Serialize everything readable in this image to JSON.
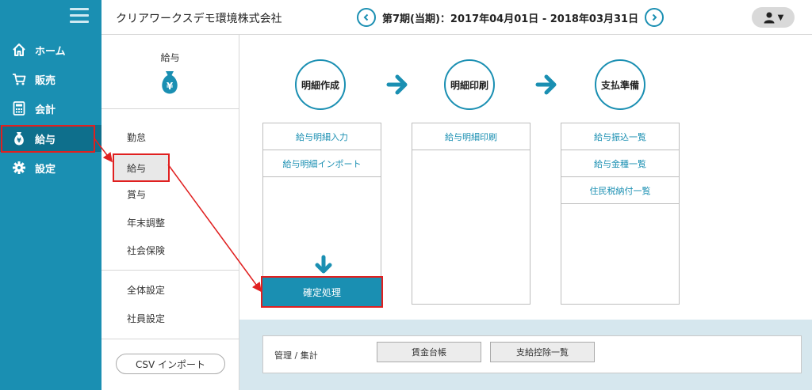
{
  "sidebar": {
    "items": [
      {
        "label": "ホーム",
        "icon": "home-icon"
      },
      {
        "label": "販売",
        "icon": "cart-icon"
      },
      {
        "label": "会計",
        "icon": "calculator-icon"
      },
      {
        "label": "給与",
        "icon": "money-bag-icon"
      },
      {
        "label": "設定",
        "icon": "gear-icon"
      }
    ],
    "active_index": 3
  },
  "header": {
    "company": "クリアワークスデモ環境株式会社",
    "period": "第7期(当期)：2017年04月01日 - 2018年03月31日"
  },
  "submenu": {
    "title": "給与",
    "groups": [
      [
        "勤怠",
        "給与",
        "賞与",
        "年末調整",
        "社会保険"
      ],
      [
        "全体設定",
        "社員設定"
      ]
    ],
    "selected": "給与",
    "csv_button": "CSV インポート"
  },
  "flow": {
    "steps": [
      {
        "label": "明細作成",
        "items": [
          "給与明細入力",
          "給与明細インポート"
        ]
      },
      {
        "label": "明細印刷",
        "items": [
          "給与明細印刷"
        ]
      },
      {
        "label": "支払準備",
        "items": [
          "給与振込一覧",
          "給与金種一覧",
          "住民税納付一覧"
        ]
      }
    ],
    "confirm_button": "確定処理"
  },
  "bottom": {
    "label": "管理 / 集計",
    "buttons": [
      "賃金台帳",
      "支給控除一覧"
    ]
  },
  "colors": {
    "accent": "#1a8fb2",
    "accent_dark": "#0e6f8c",
    "annotation": "#e02020",
    "strip": "#d6e7ee"
  }
}
